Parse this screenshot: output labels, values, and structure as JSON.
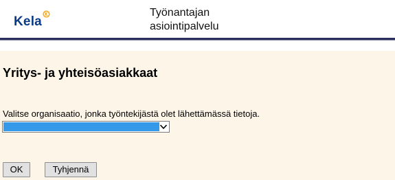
{
  "header": {
    "logo_text": "Kela",
    "title_line1": "Työnantajan",
    "title_line2": "asiointipalvelu"
  },
  "main": {
    "heading": "Yritys- ja yhteisöasiakkaat",
    "prompt": "Valitse organisaatio, jonka työntekijästä olet lähettämässä tietoja.",
    "organization_select": {
      "selected_value": ""
    },
    "buttons": {
      "ok_label": "OK",
      "clear_label": "Tyhjennä"
    }
  },
  "colors": {
    "brand_navy": "#0a3a86",
    "header_rule": "#2b2f5c",
    "content_bg": "#fdf5e8",
    "select_highlight": "#3399e8",
    "logo_badge": "#f4a81d"
  },
  "icons": {
    "logo_badge": "kela-badge-icon",
    "dropdown": "chevron-down-icon"
  }
}
